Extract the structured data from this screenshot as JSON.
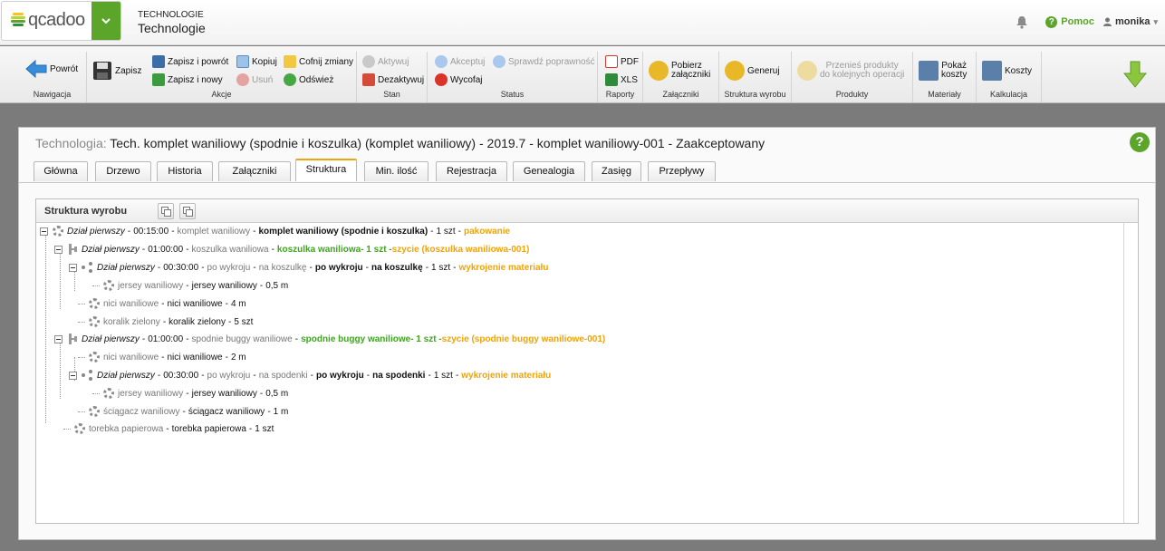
{
  "header": {
    "logo_text": "qcadoo",
    "module_category": "TECHNOLOGIE",
    "module_name": "Technologie",
    "help_label": "Pomoc",
    "user_name": "monika"
  },
  "ribbon": {
    "groups": [
      {
        "id": "nav",
        "label": "Nawigacja"
      },
      {
        "id": "actions",
        "label": "Akcje"
      },
      {
        "id": "state",
        "label": "Stan"
      },
      {
        "id": "status",
        "label": "Status"
      },
      {
        "id": "reports",
        "label": "Raporty"
      },
      {
        "id": "attachments",
        "label": "Załączniki"
      },
      {
        "id": "structure",
        "label": "Struktura wyrobu"
      },
      {
        "id": "products",
        "label": "Produkty"
      },
      {
        "id": "materials",
        "label": "Materiały"
      },
      {
        "id": "costing",
        "label": "Kalkulacja"
      }
    ],
    "buttons": {
      "back": "Powrót",
      "save": "Zapisz",
      "save_back": "Zapisz i powrót",
      "save_new": "Zapisz i nowy",
      "copy": "Kopiuj",
      "delete": "Usuń",
      "undo": "Cofnij zmiany",
      "refresh": "Odśwież",
      "activate": "Aktywuj",
      "deactivate": "Dezaktywuj",
      "accept": "Akceptuj",
      "check": "Sprawdź poprawność",
      "withdraw": "Wycofaj",
      "pdf": "PDF",
      "xls": "XLS",
      "download_attachments_1": "Pobierz",
      "download_attachments_2": "załączniki",
      "generate": "Generuj",
      "move_products_1": "Przenieś produkty",
      "move_products_2": "do kolejnych operacji",
      "show_costs_1": "Pokaż",
      "show_costs_2": "koszty",
      "costs": "Koszty"
    }
  },
  "panel": {
    "title_prefix": "Technologia:",
    "title": "Tech. komplet waniliowy (spodnie i koszulka) (komplet waniliowy) - 2019.7 - komplet waniliowy-001 - Zaakceptowany",
    "tabs": [
      "Główna",
      "Drzewo",
      "Historia",
      "Załączniki",
      "Struktura",
      "Min. ilość",
      "Rejestracja",
      "Genealogia",
      "Zasięg",
      "Przepływy"
    ],
    "active_tab": "Struktura"
  },
  "structure": {
    "title": "Struktura wyrobu",
    "rows": [
      {
        "icon": "gear",
        "parts": [
          {
            "s": "it",
            "t": "Dział pierwszy"
          },
          {
            "s": "sep",
            "t": "-"
          },
          {
            "s": "blk",
            "t": "00:15:00"
          },
          {
            "s": "sep",
            "t": "-"
          },
          {
            "s": "gray",
            "t": "komplet waniliowy"
          },
          {
            "s": "sep",
            "t": "-"
          },
          {
            "s": "bold",
            "t": "komplet waniliowy (spodnie i koszulka)"
          },
          {
            "s": "sep",
            "t": "-"
          },
          {
            "s": "blk",
            "t": "1 szt"
          },
          {
            "s": "sep",
            "t": "-"
          },
          {
            "s": "orange",
            "t": "pakowanie"
          }
        ]
      },
      {
        "icon": "struct",
        "parts": [
          {
            "s": "it",
            "t": "Dział pierwszy"
          },
          {
            "s": "sep",
            "t": "-"
          },
          {
            "s": "blk",
            "t": "01:00:00"
          },
          {
            "s": "sep",
            "t": "-"
          },
          {
            "s": "gray",
            "t": "koszulka waniliowa"
          },
          {
            "s": "sep",
            "t": "-"
          },
          {
            "s": "green",
            "t": "koszulka waniliowa"
          },
          {
            "s": "green",
            "t": " - 1 szt - "
          },
          {
            "s": "orange",
            "t": "szycie (koszulka waniliowa-001)"
          }
        ]
      },
      {
        "icon": "share",
        "parts": [
          {
            "s": "it",
            "t": "Dział pierwszy"
          },
          {
            "s": "sep",
            "t": "-"
          },
          {
            "s": "blk",
            "t": "00:30:00"
          },
          {
            "s": "sep",
            "t": "-"
          },
          {
            "s": "gray",
            "t": "po wykroju"
          },
          {
            "s": "sep",
            "t": "-"
          },
          {
            "s": "gray",
            "t": "na koszulkę"
          },
          {
            "s": "sep",
            "t": "-"
          },
          {
            "s": "bold",
            "t": "po wykroju"
          },
          {
            "s": "sep",
            "t": "-"
          },
          {
            "s": "bold",
            "t": "na koszulkę"
          },
          {
            "s": "sep",
            "t": "-"
          },
          {
            "s": "blk",
            "t": "1 szt"
          },
          {
            "s": "sep",
            "t": "-"
          },
          {
            "s": "orange",
            "t": "wykrojenie materiału"
          }
        ]
      },
      {
        "icon": "gear",
        "parts": [
          {
            "s": "gray",
            "t": "jersey waniliowy"
          },
          {
            "s": "sep",
            "t": "-"
          },
          {
            "s": "blk",
            "t": "jersey waniliowy"
          },
          {
            "s": "sep",
            "t": "-"
          },
          {
            "s": "blk",
            "t": "0,5 m"
          }
        ]
      },
      {
        "icon": "gear",
        "parts": [
          {
            "s": "gray",
            "t": "nici waniliowe"
          },
          {
            "s": "sep",
            "t": "-"
          },
          {
            "s": "blk",
            "t": "nici waniliowe"
          },
          {
            "s": "sep",
            "t": "-"
          },
          {
            "s": "blk",
            "t": "4 m"
          }
        ]
      },
      {
        "icon": "gear",
        "parts": [
          {
            "s": "gray",
            "t": "koralik zielony"
          },
          {
            "s": "sep",
            "t": "-"
          },
          {
            "s": "blk",
            "t": "koralik zielony"
          },
          {
            "s": "sep",
            "t": "-"
          },
          {
            "s": "blk",
            "t": "5 szt"
          }
        ]
      },
      {
        "icon": "struct",
        "parts": [
          {
            "s": "it",
            "t": "Dział pierwszy"
          },
          {
            "s": "sep",
            "t": "-"
          },
          {
            "s": "blk",
            "t": "01:00:00"
          },
          {
            "s": "sep",
            "t": "-"
          },
          {
            "s": "gray",
            "t": "spodnie buggy waniliowe"
          },
          {
            "s": "sep",
            "t": "-"
          },
          {
            "s": "green",
            "t": "spodnie buggy waniliowe"
          },
          {
            "s": "green",
            "t": " - 1 szt - "
          },
          {
            "s": "orange",
            "t": "szycie (spodnie buggy waniliowe-001)"
          }
        ]
      },
      {
        "icon": "gear",
        "parts": [
          {
            "s": "gray",
            "t": "nici waniliowe"
          },
          {
            "s": "sep",
            "t": "-"
          },
          {
            "s": "blk",
            "t": "nici waniliowe"
          },
          {
            "s": "sep",
            "t": "-"
          },
          {
            "s": "blk",
            "t": "2 m"
          }
        ]
      },
      {
        "icon": "share",
        "parts": [
          {
            "s": "it",
            "t": "Dział pierwszy"
          },
          {
            "s": "sep",
            "t": "-"
          },
          {
            "s": "blk",
            "t": "00:30:00"
          },
          {
            "s": "sep",
            "t": "-"
          },
          {
            "s": "gray",
            "t": "po wykroju"
          },
          {
            "s": "sep",
            "t": "-"
          },
          {
            "s": "gray",
            "t": "na spodenki"
          },
          {
            "s": "sep",
            "t": "-"
          },
          {
            "s": "bold",
            "t": "po wykroju"
          },
          {
            "s": "sep",
            "t": "-"
          },
          {
            "s": "bold",
            "t": "na spodenki"
          },
          {
            "s": "sep",
            "t": "-"
          },
          {
            "s": "blk",
            "t": "1 szt"
          },
          {
            "s": "sep",
            "t": "-"
          },
          {
            "s": "orange",
            "t": "wykrojenie materiału"
          }
        ]
      },
      {
        "icon": "gear",
        "parts": [
          {
            "s": "gray",
            "t": "jersey waniliowy"
          },
          {
            "s": "sep",
            "t": "-"
          },
          {
            "s": "blk",
            "t": "jersey waniliowy"
          },
          {
            "s": "sep",
            "t": "-"
          },
          {
            "s": "blk",
            "t": "0,5 m"
          }
        ]
      },
      {
        "icon": "gear",
        "parts": [
          {
            "s": "gray",
            "t": "ściągacz waniliowy"
          },
          {
            "s": "sep",
            "t": "-"
          },
          {
            "s": "blk",
            "t": "ściągacz waniliowy"
          },
          {
            "s": "sep",
            "t": "-"
          },
          {
            "s": "blk",
            "t": "1 m"
          }
        ]
      },
      {
        "icon": "gear",
        "parts": [
          {
            "s": "gray",
            "t": "torebka papierowa"
          },
          {
            "s": "sep",
            "t": "-"
          },
          {
            "s": "blk",
            "t": "torebka papierowa"
          },
          {
            "s": "sep",
            "t": "-"
          },
          {
            "s": "blk",
            "t": "1 szt"
          }
        ]
      }
    ]
  },
  "colors": {
    "accent_green": "#5aa52a",
    "ready_green": "#3ea51e",
    "operation_orange": "#f0a30a",
    "active_tab": "#f0a30a"
  }
}
